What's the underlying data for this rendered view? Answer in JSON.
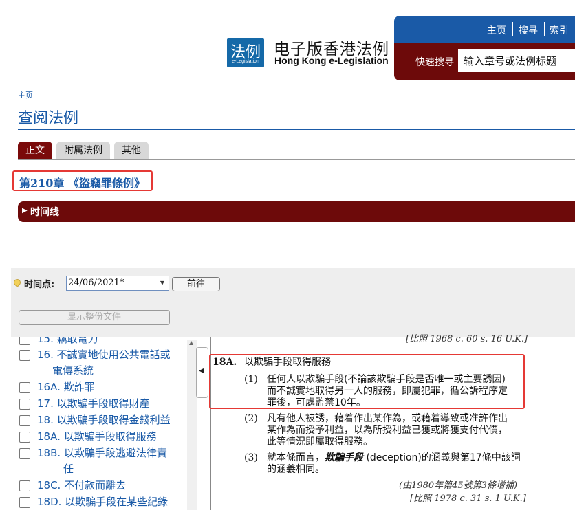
{
  "header": {
    "logo_big": "法例",
    "logo_small": "e-Legislation",
    "site_name_cn": "电子版香港法例",
    "site_name_en": "Hong Kong e-Legislation",
    "nav": [
      "主页",
      "搜寻",
      "索引"
    ],
    "quick_search_label": "快速搜寻",
    "quick_search_value": "输入章号或法例标题"
  },
  "breadcrumb": "主页",
  "page_title": "查阅法例",
  "tabs": [
    "正文",
    "附属法例",
    "其他"
  ],
  "chapter_title": "第210章 《盜竊罪條例》",
  "timeline_label": "时间线",
  "time_point": {
    "label": "时间点:",
    "value": "24/06/2021*",
    "go_label": "前往"
  },
  "show_full_label": "显示整份文件",
  "sections": [
    {
      "line1": "15. 竊取電力",
      "line2": ""
    },
    {
      "line1": "16. 不誠實地使用公共電話或",
      "line2": "電傳系統"
    },
    {
      "line1": "16A. 欺詐罪",
      "line2": ""
    },
    {
      "line1": "17. 以欺騙手段取得財產",
      "line2": ""
    },
    {
      "line1": "18. 以欺騙手段取得金錢利益",
      "line2": ""
    },
    {
      "line1": "18A. 以欺騙手段取得服務",
      "line2": ""
    },
    {
      "line1": "18B. 以欺騙手段逃避法律責",
      "line2": "任"
    },
    {
      "line1": "18C. 不付款而離去",
      "line2": ""
    },
    {
      "line1": "18D. 以欺騙手段在某些紀錄",
      "line2": ""
    }
  ],
  "document": {
    "prev_ref": "[比照 1968 c. 60 s. 16 U.K.]",
    "section_no": "18A.",
    "section_title": "以欺騙手段取得服務",
    "sub1_no": "(1)",
    "sub1_l1": "任何人以欺騙手段(不論該欺騙手段是否唯一或主要誘因)",
    "sub1_l2": "而不誠實地取得另一人的服務，即屬犯罪，循公訴程序定",
    "sub1_l3": "罪後，可處監禁10年。",
    "sub2_no": "(2)",
    "sub2_l1": "凡有他人被誘，藉着作出某作為，或藉着導致或准許作出",
    "sub2_l2": "某作為而授予利益，以為所授利益已獲或將獲支付代價，",
    "sub2_l3": "此等情況即屬取得服務。",
    "sub3_no": "(3)",
    "sub3_pre": "就本條而言，",
    "sub3_term": "欺騙手段",
    "sub3_post": " (deception)的涵義與第17條中該詞",
    "sub3_l2": "的涵義相同。",
    "amend_note": "(由1980年第45號第3條增補)",
    "compare_note": "[比照 1978 c. 31 s. 1 U.K.]"
  }
}
